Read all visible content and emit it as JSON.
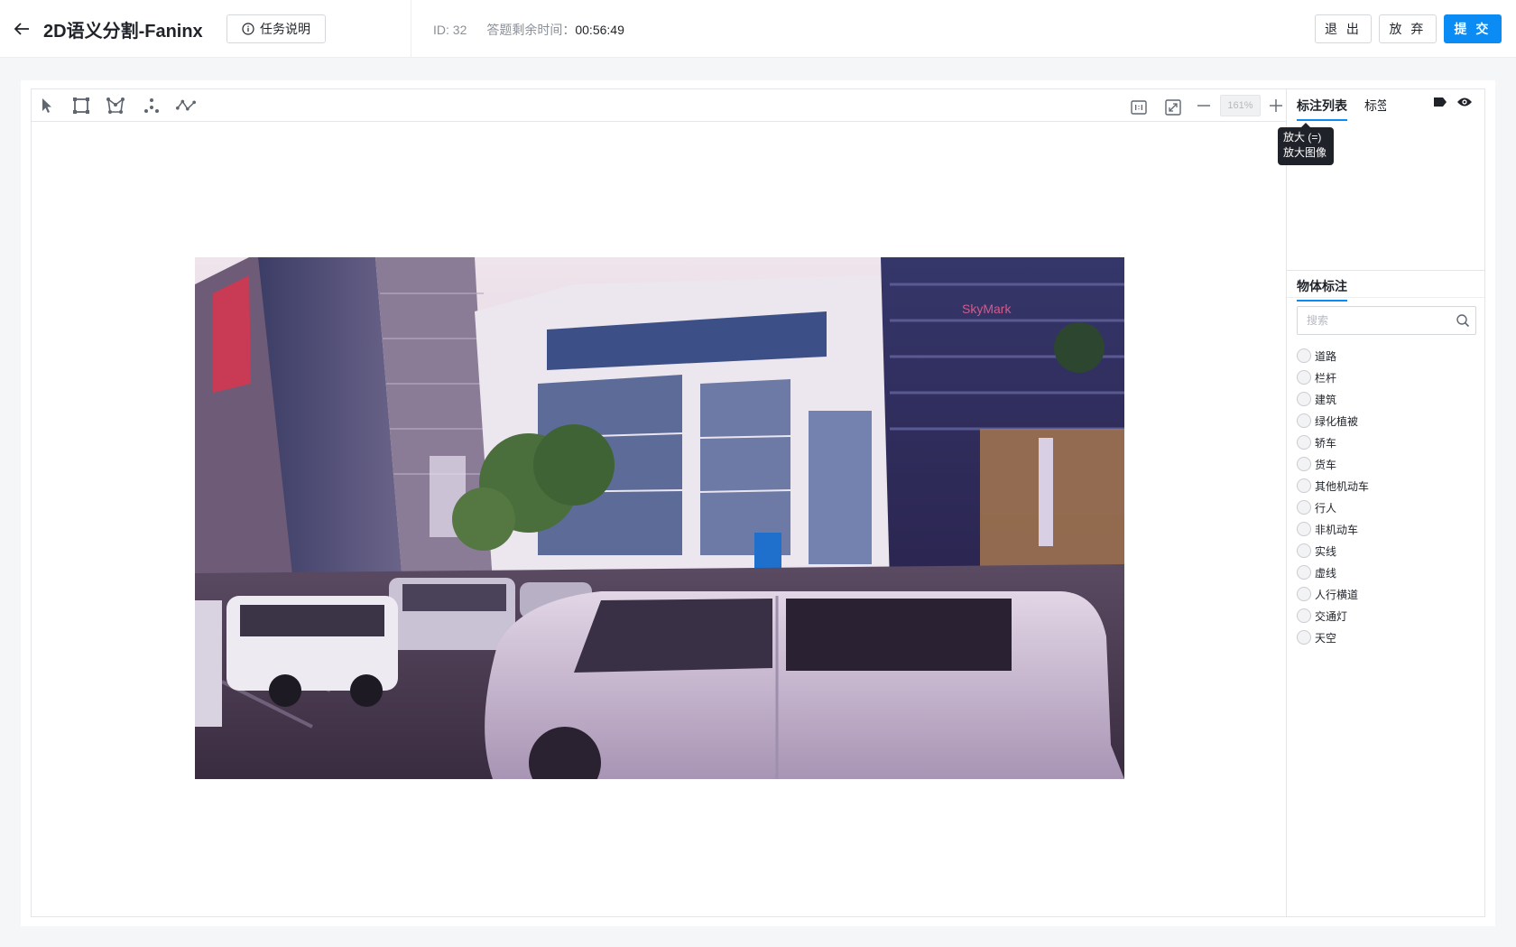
{
  "header": {
    "title": "2D语义分割-Faninx",
    "task_button": "任务说明",
    "id_label": "ID: 32",
    "time_label": "答题剩余时间：",
    "time_value": "00:56:49",
    "exit": "退 出",
    "abandon": "放 弃",
    "submit": "提 交"
  },
  "canvas": {
    "zoom_value": "161%"
  },
  "panel": {
    "tab_active": "标注列表",
    "tab_second": "标签",
    "tooltip_line1": "放大 (=)",
    "tooltip_line2": "放大图像",
    "object_title": "物体标注",
    "search_placeholder": "搜索",
    "labels": [
      "道路",
      "栏杆",
      "建筑",
      "绿化植被",
      "轿车",
      "货车",
      "其他机动车",
      "行人",
      "非机动车",
      "实线",
      "虚线",
      "人行横道",
      "交通灯",
      "天空"
    ]
  },
  "colors": {
    "accent": "#0b8cf5"
  }
}
